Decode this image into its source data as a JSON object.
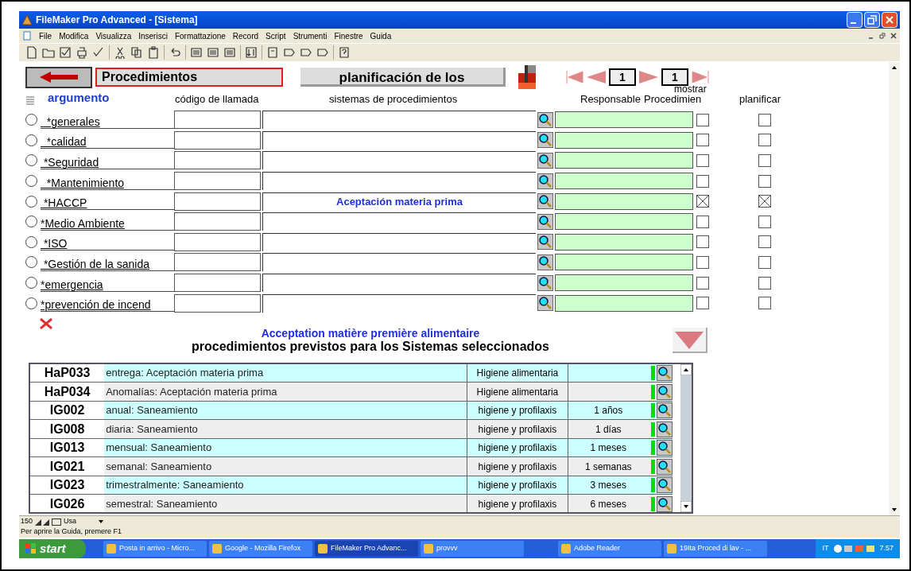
{
  "window": {
    "title": "FileMaker Pro Advanced - [Sistema]"
  },
  "menu": [
    "File",
    "Modifica",
    "Visualizza",
    "Inserisci",
    "Formattazione",
    "Record",
    "Script",
    "Strumenti",
    "Finestre",
    "Guida"
  ],
  "header": {
    "title_field": "Procedimientos",
    "planning_button": "planificación de los",
    "record_number": "1",
    "shown_count": "1",
    "show_label": "mostrar"
  },
  "columns": [
    "argumento",
    "código de llamada",
    "sistemas de procedimientos",
    "Responsable",
    "Procedimien",
    "planificar"
  ],
  "topics": [
    {
      "label": "  *generales",
      "selected": false,
      "procedimien_checked": false,
      "planificar_checked": false
    },
    {
      "label": "  *calidad",
      "selected": false,
      "procedimien_checked": false,
      "planificar_checked": false
    },
    {
      "label": " *Seguridad",
      "selected": false,
      "procedimien_checked": false,
      "planificar_checked": false
    },
    {
      "label": "  *Mantenimiento",
      "selected": false,
      "procedimien_checked": false,
      "planificar_checked": false
    },
    {
      "label": " *HACCP",
      "selected": false,
      "system": "Aceptación materia prima",
      "procedimien_checked": true,
      "planificar_checked": true
    },
    {
      "label": "*Medio Ambiente",
      "selected": false,
      "procedimien_checked": false,
      "planificar_checked": false
    },
    {
      "label": " *ISO",
      "selected": false,
      "procedimien_checked": false,
      "planificar_checked": false
    },
    {
      "label": " *Gestión de la sanida",
      "selected": false,
      "procedimien_checked": false,
      "planificar_checked": false
    },
    {
      "label": "*emergencia",
      "selected": false,
      "procedimien_checked": false,
      "planificar_checked": false
    },
    {
      "label": "*prevención de incend",
      "selected": false,
      "procedimien_checked": false,
      "planificar_checked": false
    }
  ],
  "subtitle": "Acceptation matière première alimentaire",
  "portal_title": "procedimientos previstos para los Sistemas seleccionados",
  "portal_rows": [
    {
      "code": "HaP033",
      "description": "entrega: Aceptación materia prima",
      "category": "Higiene alimentaria"
    },
    {
      "code": "HaP034",
      "description": "Anomalías: Aceptación materia prima",
      "category": "Higiene alimentaria"
    },
    {
      "code": "IG002",
      "description": "anual: Saneamiento",
      "category": "higiene y profilaxis",
      "period": "1 años"
    },
    {
      "code": "IG008",
      "description": "diaria: Saneamiento",
      "category": "higiene y profilaxis",
      "period": "1 días"
    },
    {
      "code": "IG013",
      "description": "mensual: Saneamiento",
      "category": "higiene y profilaxis",
      "period": "1 meses"
    },
    {
      "code": "IG021",
      "description": "semanal: Saneamiento",
      "category": "higiene y profilaxis",
      "period": "1 semanas"
    },
    {
      "code": "IG023",
      "description": "trimestralmente: Saneamiento",
      "category": "higiene y profilaxis",
      "period": "3 meses"
    },
    {
      "code": "IG026",
      "description": "semestral: Saneamiento",
      "category": "higiene y profilaxis",
      "period": "6 meses"
    }
  ],
  "bottom_bar": {
    "zoom": "150",
    "mode": "Usa"
  },
  "status_bar": "Per aprire la Guida, premere F1",
  "taskbar": {
    "start": "start",
    "items": [
      {
        "label": "Posta in arrivo - Micro...",
        "selected": false
      },
      {
        "label": "Google - Mozilla Firefox",
        "selected": false
      },
      {
        "label": "FileMaker Pro Advanc...",
        "selected": true
      },
      {
        "label": "provvv",
        "selected": false
      },
      {
        "label": "Adobe Reader",
        "selected": false
      },
      {
        "label": "19Ita Proced di lav - ...",
        "selected": false
      }
    ],
    "language": "IT",
    "clock": "7.57"
  }
}
